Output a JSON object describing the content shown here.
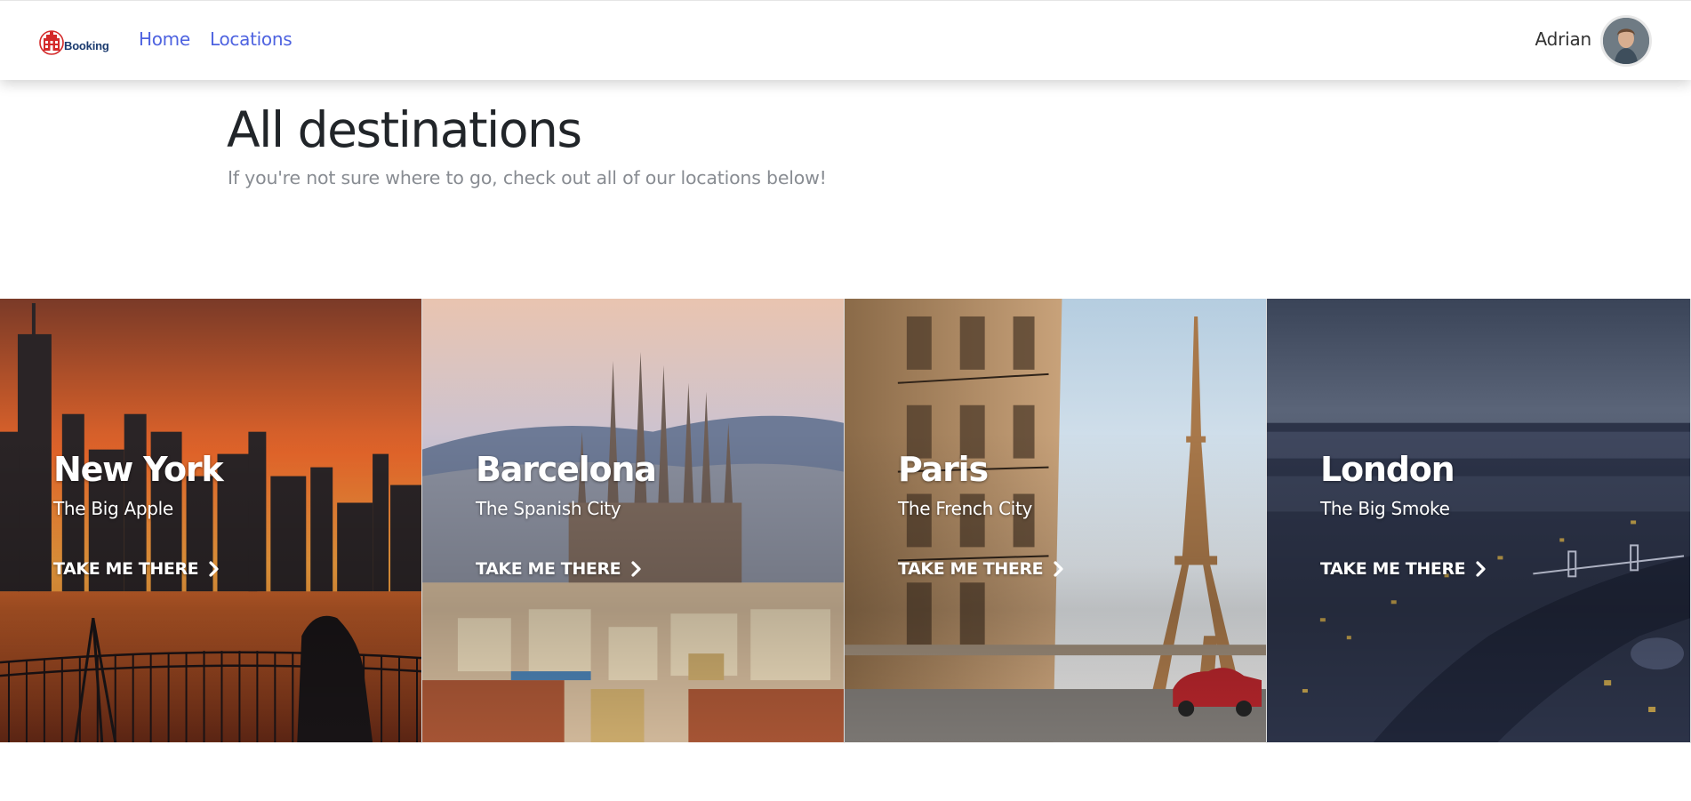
{
  "brand": {
    "logo_text": "Booking"
  },
  "nav": {
    "links": [
      {
        "label": "Home"
      },
      {
        "label": "Locations"
      }
    ],
    "link_color": "#4e63e0"
  },
  "user": {
    "name": "Adrian"
  },
  "page": {
    "title": "All destinations",
    "subtitle": "If you're not sure where to go, check out all of our locations below!"
  },
  "destinations": [
    {
      "name": "New York",
      "tagline": "The Big Apple",
      "cta": "TAKE ME THERE"
    },
    {
      "name": "Barcelona",
      "tagline": "The Spanish City",
      "cta": "TAKE ME THERE"
    },
    {
      "name": "Paris",
      "tagline": "The French City",
      "cta": "TAKE ME THERE"
    },
    {
      "name": "London",
      "tagline": "The Big Smoke",
      "cta": "TAKE ME THERE"
    }
  ]
}
